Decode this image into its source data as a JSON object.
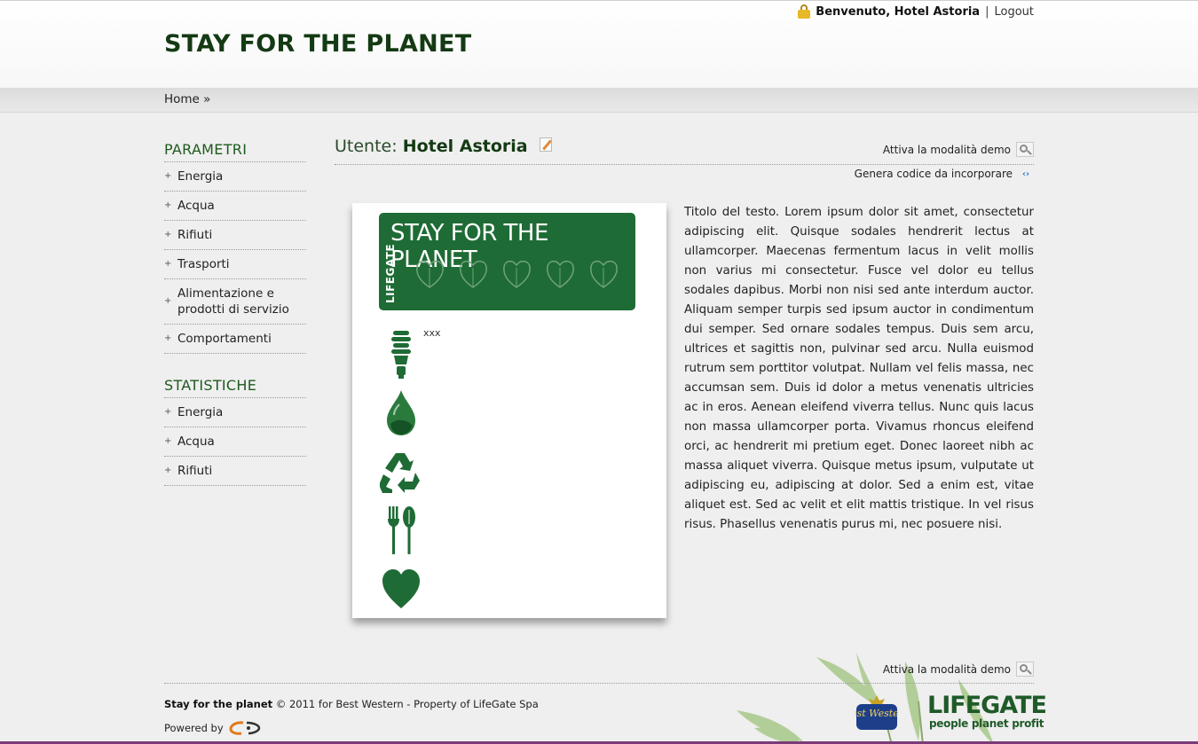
{
  "header": {
    "site_title": "STAY FOR THE PLANET",
    "welcome": "Benvenuto, Hotel Astoria",
    "separator": "|",
    "logout": "Logout"
  },
  "breadcrumb": {
    "home": "Home »"
  },
  "sidebar": {
    "parametri_title": "PARAMETRI",
    "parametri_items": [
      {
        "label": "Energia"
      },
      {
        "label": "Acqua"
      },
      {
        "label": "Rifiuti"
      },
      {
        "label": "Trasporti"
      },
      {
        "label": "Alimentazione e prodotti di servizio"
      },
      {
        "label": "Comportamenti"
      }
    ],
    "statistiche_title": "STATISTICHE",
    "statistiche_items": [
      {
        "label": "Energia"
      },
      {
        "label": "Acqua"
      },
      {
        "label": "Rifiuti"
      }
    ],
    "bullet": "+"
  },
  "main": {
    "user_prefix": "Utente:",
    "user_name": "Hotel Astoria",
    "demo_link": "Attiva la modalità demo",
    "embed_link": "Genera codice da incorporare",
    "widget": {
      "banner_title": "STAY FOR THE PLANET",
      "banner_brand": "LIFEGATE",
      "placeholder_text": "xxx",
      "accent_color": "#1f6b35",
      "icons": [
        "bulb-icon",
        "water-drop-icon",
        "recycle-icon",
        "cutlery-icon",
        "heart-icon"
      ]
    },
    "body_text": "Titolo del testo. Lorem ipsum dolor sit amet, consectetur adipiscing elit. Quisque sodales hendrerit lectus at ullamcorper. Maecenas fermentum lacus in velit mollis non varius mi consectetur. Fusce vel dolor eu tellus sodales dapibus. Morbi non nisi sed ante interdum auctor. Aliquam semper turpis sed ipsum auctor in condimentum dui semper. Sed ornare sodales tempus. Duis sem arcu, ultrices et sagittis non, pulvinar sed arcu. Nulla euismod rutrum sem porttitor volutpat. Nullam vel felis massa, nec accumsan sem. Duis id dolor a metus venenatis ultricies ac in eros. Aenean eleifend viverra tellus. Nunc quis lacus non massa ullamcorper porta. Vivamus rhoncus eleifend orci, ac hendrerit mi pretium eget. Donec laoreet nibh ac massa aliquet viverra. Quisque metus ipsum, vulputate ut adipiscing eu, adipiscing at dolor. Sed a enim est, vitae aliquet est. Sed ac velit et elit mattis tristique. In vel risus risus. Phasellus venenatis purus mi, nec posuere nisi."
  },
  "footer": {
    "demo_link": "Attiva la modalità demo",
    "brand": "Stay for the planet",
    "copyright": " © 2011 for Best Western - Property of LifeGate Spa",
    "powered_by": "Powered by",
    "bw_logo": "Best Western",
    "lifegate_word": "LIFEGATE",
    "lifegate_tagline": "people planet profit"
  },
  "colors": {
    "brand_green": "#143a14",
    "widget_green": "#1f6b35",
    "page_bg": "#efefef"
  }
}
